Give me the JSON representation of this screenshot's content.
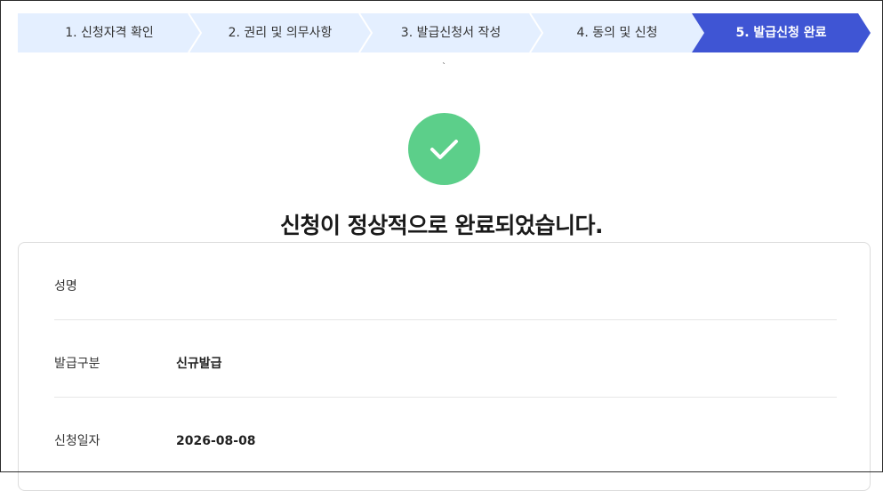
{
  "steps": [
    {
      "label": "1. 신청자격 확인",
      "active": false
    },
    {
      "label": "2. 권리 및 의무사항",
      "active": false
    },
    {
      "label": "3. 발급신청서 작성",
      "active": false
    },
    {
      "label": "4. 동의 및 신청",
      "active": false
    },
    {
      "label": "5. 발급신청 완료",
      "active": true
    }
  ],
  "stray_mark": "`",
  "title": "신청이 정상적으로 완료되었습니다.",
  "info": {
    "rows": [
      {
        "label": "성명",
        "value": ""
      },
      {
        "label": "발급구분",
        "value": "신규발급"
      },
      {
        "label": "신청일자",
        "value": "2026-08-08"
      }
    ]
  },
  "colors": {
    "step_inactive": "#e4efff",
    "step_active": "#3f55d4",
    "success": "#5ccf8a"
  },
  "icons": {
    "success": "check-icon"
  }
}
